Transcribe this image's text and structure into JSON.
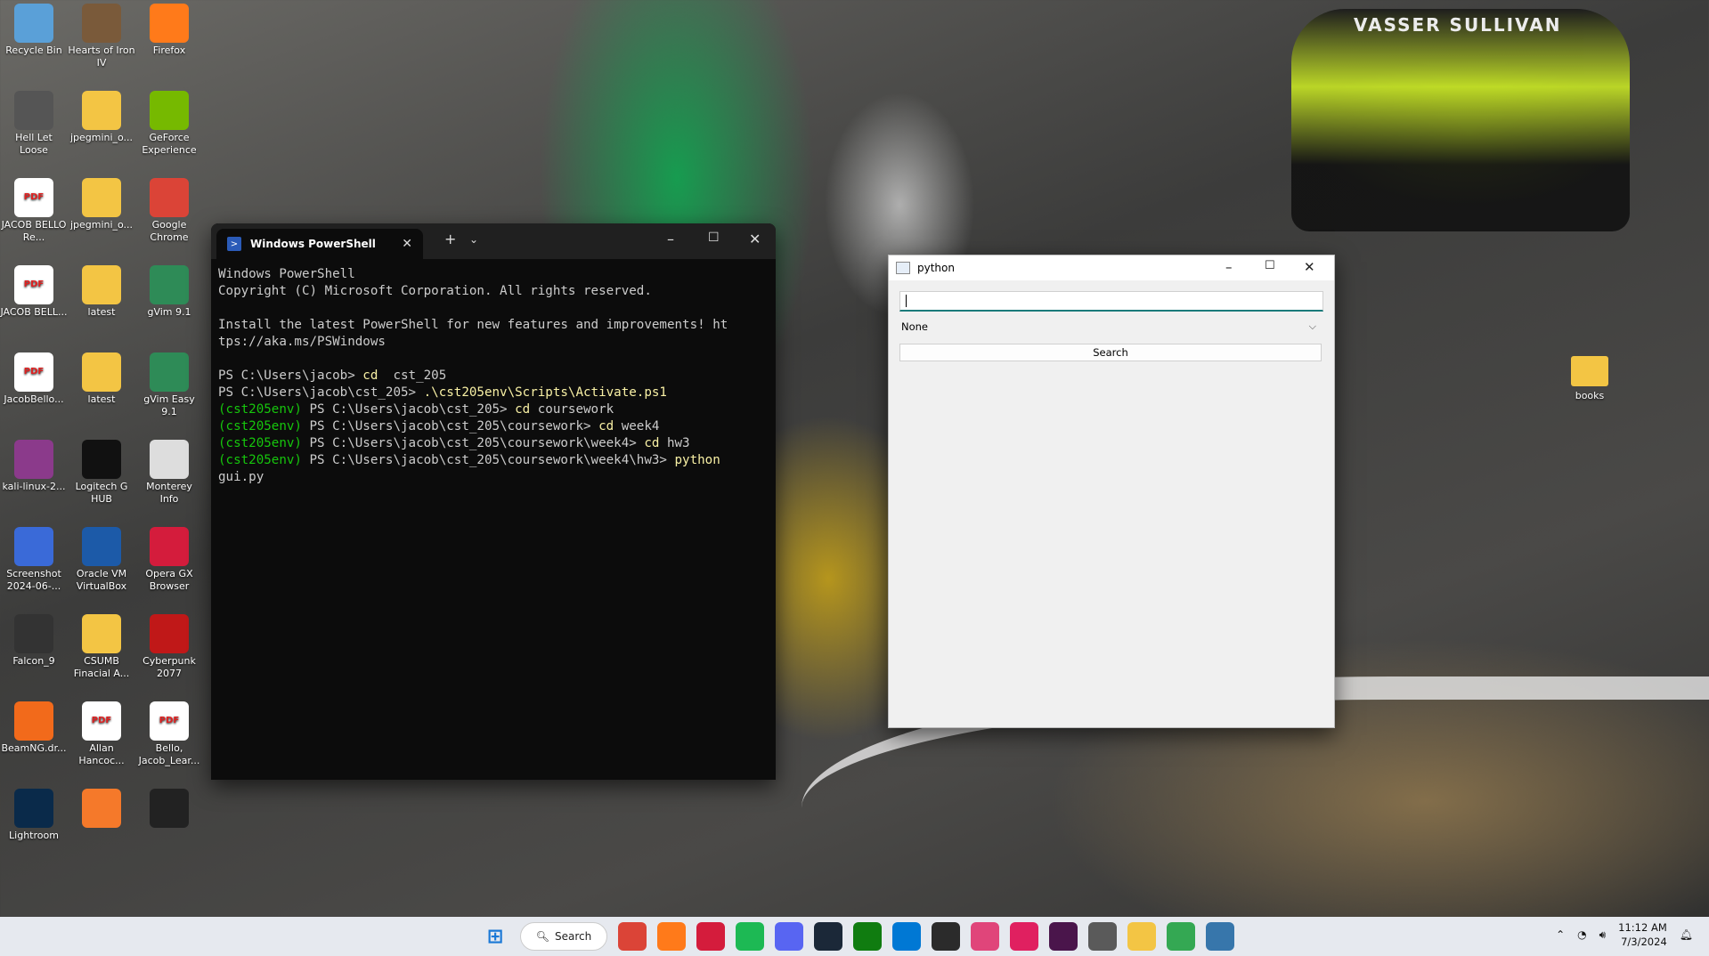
{
  "wallpaper": {
    "car_sponsor_text": "VASSER SULLIVAN"
  },
  "desktop_icons": [
    {
      "label": "Recycle Bin",
      "icon": "recycle-bin-icon",
      "color": "#5aa0d8"
    },
    {
      "label": "Hearts of Iron IV",
      "icon": "hoi4-icon",
      "color": "#7a5a3a"
    },
    {
      "label": "Firefox",
      "icon": "firefox-icon",
      "color": "#ff7a1a"
    },
    {
      "label": "Hell Let Loose",
      "icon": "hell-let-loose-icon",
      "color": "#555"
    },
    {
      "label": "jpegmini_o...",
      "icon": "folder-icon",
      "color": "#f3c544"
    },
    {
      "label": "GeForce Experience",
      "icon": "nvidia-icon",
      "color": "#76b900"
    },
    {
      "label": "JACOB BELLO Re...",
      "icon": "pdf-icon",
      "color": "#e02020"
    },
    {
      "label": "jpegmini_o...",
      "icon": "folder-icon",
      "color": "#f3c544"
    },
    {
      "label": "Google Chrome",
      "icon": "chrome-icon",
      "color": "#db4437"
    },
    {
      "label": "JACOB BELL...",
      "icon": "pdf-icon",
      "color": "#e02020"
    },
    {
      "label": "latest",
      "icon": "folder-icon",
      "color": "#f3c544"
    },
    {
      "label": "gVim 9.1",
      "icon": "vim-icon",
      "color": "#2e8b57"
    },
    {
      "label": "JacobBello...",
      "icon": "pdf-icon",
      "color": "#e02020"
    },
    {
      "label": "latest",
      "icon": "folder-icon",
      "color": "#f3c544"
    },
    {
      "label": "gVim Easy 9.1",
      "icon": "vim-icon",
      "color": "#2e8b57"
    },
    {
      "label": "kali-linux-2...",
      "icon": "winrar-icon",
      "color": "#8b3a8b"
    },
    {
      "label": "Logitech G HUB",
      "icon": "logitech-icon",
      "color": "#111"
    },
    {
      "label": "Monterey Info",
      "icon": "document-icon",
      "color": "#ddd"
    },
    {
      "label": "Screenshot 2024-06-...",
      "icon": "image-icon",
      "color": "#3a6ad8"
    },
    {
      "label": "Oracle VM VirtualBox",
      "icon": "virtualbox-icon",
      "color": "#1c5aa8"
    },
    {
      "label": "Opera GX Browser",
      "icon": "opera-icon",
      "color": "#d41c3c"
    },
    {
      "label": "Falcon_9",
      "icon": "video-icon",
      "color": "#333"
    },
    {
      "label": "CSUMB Finacial A...",
      "icon": "folder-icon",
      "color": "#f3c544"
    },
    {
      "label": "Cyberpunk 2077",
      "icon": "cyberpunk-icon",
      "color": "#c01818"
    },
    {
      "label": "BeamNG.dr...",
      "icon": "beamng-icon",
      "color": "#f26a1b"
    },
    {
      "label": "Allan Hancoc...",
      "icon": "pdf-icon",
      "color": "#e02020"
    },
    {
      "label": "Bello, Jacob_Lear...",
      "icon": "pdf-icon",
      "color": "#e02020"
    },
    {
      "label": "Lightroom",
      "icon": "lightroom-icon",
      "color": "#0a2a4a"
    },
    {
      "label": "",
      "icon": "blender-icon",
      "color": "#f5792a"
    },
    {
      "label": "",
      "icon": "image-icon",
      "color": "#222"
    }
  ],
  "books_icon": {
    "label": "books"
  },
  "powershell": {
    "tab_title": "Windows PowerShell",
    "lines": [
      {
        "t": "Windows PowerShell",
        "c": ""
      },
      {
        "t": "Copyright (C) Microsoft Corporation. All rights reserved.",
        "c": ""
      },
      {
        "t": "",
        "c": ""
      },
      {
        "t": "Install the latest PowerShell for new features and improvements! ht",
        "c": ""
      },
      {
        "t": "tps://aka.ms/PSWindows",
        "c": ""
      },
      {
        "t": "",
        "c": ""
      }
    ],
    "cmds": [
      {
        "env": "",
        "prompt": "PS C:\\Users\\jacob> ",
        "cmd": "cd",
        "arg": "  cst_205"
      },
      {
        "env": "",
        "prompt": "PS C:\\Users\\jacob\\cst_205> ",
        "cmd": ".\\cst205env\\Scripts\\Activate.ps1",
        "arg": ""
      },
      {
        "env": "(cst205env) ",
        "prompt": "PS C:\\Users\\jacob\\cst_205> ",
        "cmd": "cd",
        "arg": " coursework"
      },
      {
        "env": "(cst205env) ",
        "prompt": "PS C:\\Users\\jacob\\cst_205\\coursework> ",
        "cmd": "cd",
        "arg": " week4"
      },
      {
        "env": "(cst205env) ",
        "prompt": "PS C:\\Users\\jacob\\cst_205\\coursework\\week4> ",
        "cmd": "cd",
        "arg": " hw3"
      },
      {
        "env": "(cst205env) ",
        "prompt": "PS C:\\Users\\jacob\\cst_205\\coursework\\week4\\hw3> ",
        "cmd": "python",
        "arg": ""
      }
    ],
    "last_line": "gui.py"
  },
  "python_window": {
    "title": "python",
    "entry_value": "",
    "select_value": "None",
    "button_label": "Search"
  },
  "taskbar": {
    "search_label": "Search",
    "apps": [
      {
        "name": "chrome-icon",
        "color": "#db4437"
      },
      {
        "name": "firefox-icon",
        "color": "#ff7a1a"
      },
      {
        "name": "opera-icon",
        "color": "#d41c3c"
      },
      {
        "name": "spotify-icon",
        "color": "#1db954"
      },
      {
        "name": "discord-icon",
        "color": "#5865f2"
      },
      {
        "name": "steam-icon",
        "color": "#1b2838"
      },
      {
        "name": "xbox-icon",
        "color": "#107c10"
      },
      {
        "name": "vscode-icon",
        "color": "#0078d4"
      },
      {
        "name": "terminal-icon",
        "color": "#2b2b2b"
      },
      {
        "name": "gallery-icon",
        "color": "#e0457a"
      },
      {
        "name": "intellij-icon",
        "color": "#e02060"
      },
      {
        "name": "slack-icon",
        "color": "#4a154b"
      },
      {
        "name": "settings-icon",
        "color": "#5a5a5a"
      },
      {
        "name": "file-explorer-icon",
        "color": "#f3c544"
      },
      {
        "name": "chrome-alt-icon",
        "color": "#34a853"
      },
      {
        "name": "python-icon",
        "color": "#3776ab"
      }
    ],
    "clock_time": "11:12 AM",
    "clock_date": "7/3/2024"
  }
}
